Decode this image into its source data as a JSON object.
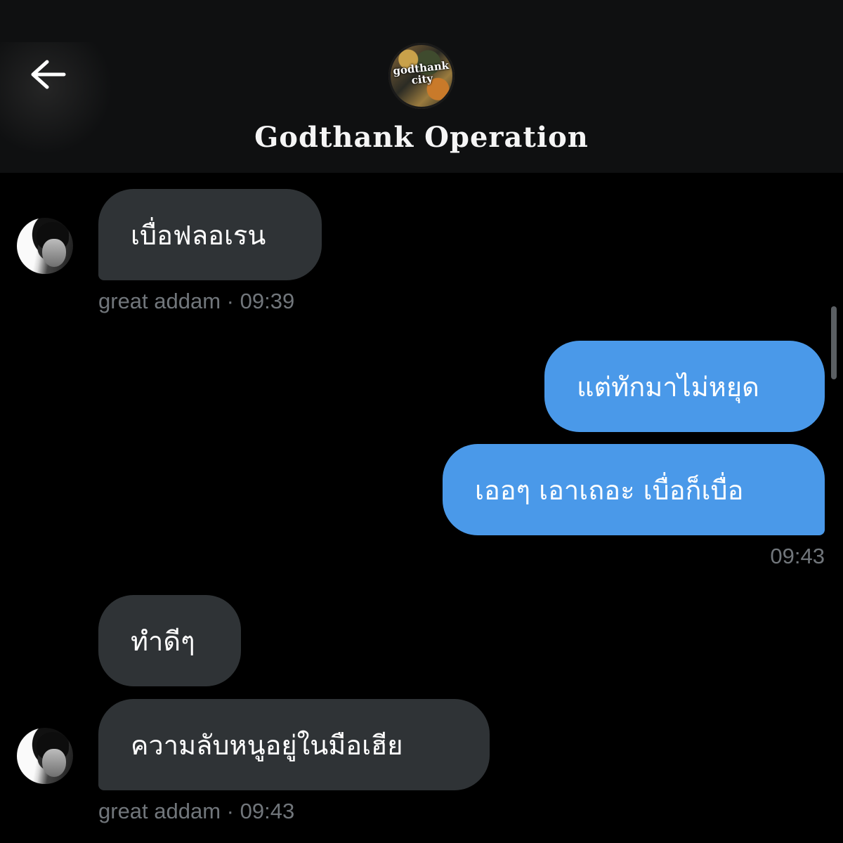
{
  "header": {
    "title": "Godthank Operation",
    "avatar_text": "godthank city",
    "back_icon": "arrow-left-icon"
  },
  "messages": [
    {
      "id": "m1",
      "direction": "incoming",
      "text": "เบื่อฟลอเรน"
    },
    {
      "id": "m2",
      "direction": "outgoing",
      "text": "แต่ทักมาไม่หยุด"
    },
    {
      "id": "m3",
      "direction": "outgoing",
      "text": "เออๆ เอาเถอะ เบื่อก็เบื่อ"
    },
    {
      "id": "m4",
      "direction": "incoming",
      "text": "ทำดีๆ"
    },
    {
      "id": "m5",
      "direction": "incoming",
      "text": "ความลับหนูอยู่ในมือเฮีย"
    }
  ],
  "meta": {
    "m1": "great addam · 09:39",
    "m3": "09:43",
    "m5": "great addam · 09:43"
  },
  "colors": {
    "background": "#000000",
    "header": "#0f1011",
    "incoming_bubble": "#2f3336",
    "outgoing_bubble": "#4a99e9",
    "meta_text": "#71767b"
  }
}
